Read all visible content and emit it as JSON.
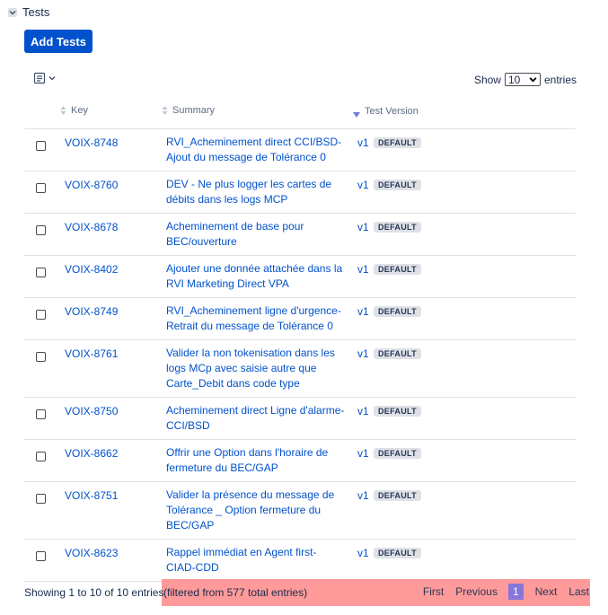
{
  "section": {
    "title": "Tests"
  },
  "toolbar": {
    "add_label": "Add Tests"
  },
  "length": {
    "show_label": "Show",
    "selected": "10",
    "entries_label": "entries"
  },
  "columns": {
    "key": "Key",
    "summary": "Summary",
    "version": "Test Version"
  },
  "rows": [
    {
      "key": "VOIX-8748",
      "summary": "RVI_Acheminement  direct CCI/BSD-Ajout  du message de Tolérance 0",
      "version": "v1",
      "badge": "DEFAULT"
    },
    {
      "key": "VOIX-8760",
      "summary": "DEV - Ne plus logger les cartes de débits dans les logs MCP",
      "version": "v1",
      "badge": "DEFAULT"
    },
    {
      "key": "VOIX-8678",
      "summary": "Acheminement de base pour BEC/ouverture",
      "version": "v1",
      "badge": "DEFAULT"
    },
    {
      "key": "VOIX-8402",
      "summary": "Ajouter une donnée attachée dans la RVI Marketing Direct  VPA",
      "version": "v1",
      "badge": "DEFAULT"
    },
    {
      "key": "VOIX-8749",
      "summary": "RVI_Acheminement ligne d'urgence-Retrait du message de Tolérance 0",
      "version": "v1",
      "badge": "DEFAULT"
    },
    {
      "key": "VOIX-8761",
      "summary": "Valider la non tokenisation dans les logs MCp avec saisie autre que Carte_Debit dans code type",
      "version": "v1",
      "badge": "DEFAULT"
    },
    {
      "key": "VOIX-8750",
      "summary": "Acheminement direct Ligne d'alarme-CCI/BSD",
      "version": "v1",
      "badge": "DEFAULT"
    },
    {
      "key": "VOIX-8662",
      "summary": "Offrir une Option dans l'horaire de fermeture du BEC/GAP",
      "version": "v1",
      "badge": "DEFAULT"
    },
    {
      "key": "VOIX-8751",
      "summary": "Valider la présence du message de Tolérance _ Option fermeture du BEC/GAP",
      "version": "v1",
      "badge": "DEFAULT"
    },
    {
      "key": "VOIX-8623",
      "summary": "Rappel immédiat en Agent first-CIAD-CDD",
      "version": "v1",
      "badge": "DEFAULT"
    }
  ],
  "footer": {
    "info": "Showing 1 to 10 of 10 entries",
    "filtered": "(filtered from 577 total entries)"
  },
  "pager": {
    "first": "First",
    "previous": "Previous",
    "current": "1",
    "next": "Next",
    "last": "Last"
  },
  "colors": {
    "accent": "#0052cc",
    "highlight": "#ff9a9a",
    "current_page": "#8777d9",
    "badge_bg": "#dfe1e6"
  }
}
